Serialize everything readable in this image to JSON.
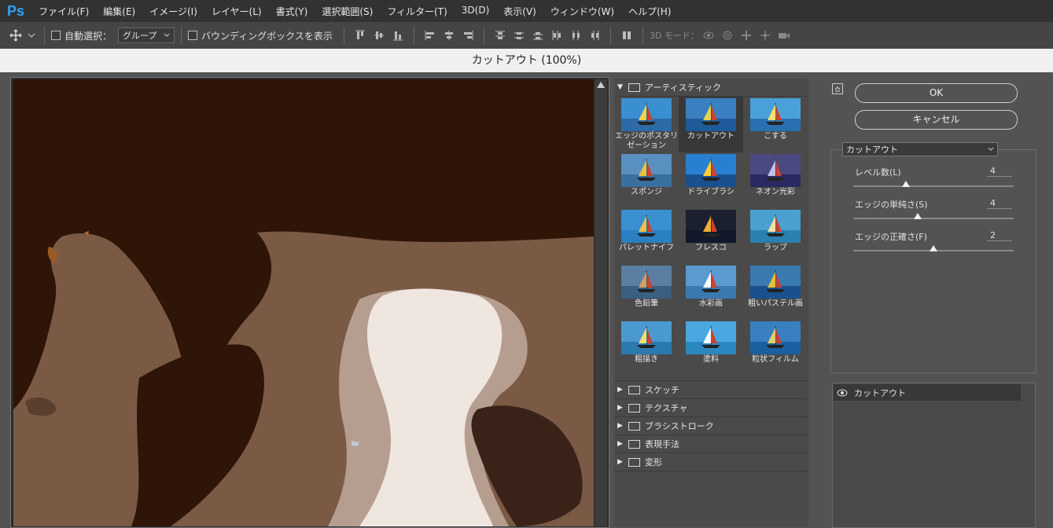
{
  "app": {
    "logo": "Ps"
  },
  "menu": [
    "ファイル(F)",
    "編集(E)",
    "イメージ(I)",
    "レイヤー(L)",
    "書式(Y)",
    "選択範囲(S)",
    "フィルター(T)",
    "3D(D)",
    "表示(V)",
    "ウィンドウ(W)",
    "ヘルプ(H)"
  ],
  "options": {
    "auto_select_label": "自動選択：",
    "auto_select_value": "グループ",
    "bbox_label": "バウンディングボックスを表示",
    "mode3d_label": "3D モード："
  },
  "dialog": {
    "title": "カットアウト (100%)"
  },
  "gallery": {
    "open_folder": "アーティスティック",
    "thumbnails": [
      {
        "label": "エッジのポスタリゼーション",
        "selected": false
      },
      {
        "label": "カットアウト",
        "selected": true
      },
      {
        "label": "こする",
        "selected": false
      },
      {
        "label": "スポンジ",
        "selected": false
      },
      {
        "label": "ドライブラシ",
        "selected": false
      },
      {
        "label": "ネオン光彩",
        "selected": false
      },
      {
        "label": "パレットナイフ",
        "selected": false
      },
      {
        "label": "フレスコ",
        "selected": false
      },
      {
        "label": "ラップ",
        "selected": false
      },
      {
        "label": "色鉛筆",
        "selected": false
      },
      {
        "label": "水彩画",
        "selected": false
      },
      {
        "label": "粗いパステル画",
        "selected": false
      },
      {
        "label": "粗描き",
        "selected": false
      },
      {
        "label": "塗料",
        "selected": false
      },
      {
        "label": "粒状フィルム",
        "selected": false
      }
    ],
    "folders": [
      "スケッチ",
      "テクスチャ",
      "ブラシストローク",
      "表現手法",
      "変形"
    ]
  },
  "buttons": {
    "ok": "OK",
    "cancel": "キャンセル"
  },
  "settings": {
    "filter": "カットアウト",
    "params": [
      {
        "label": "レベル数(L)",
        "value": "4",
        "level": 0.33
      },
      {
        "label": "エッジの単純さ(S)",
        "value": "4",
        "level": 0.4
      },
      {
        "label": "エッジの正確さ(F)",
        "value": "2",
        "level": 0.5
      }
    ]
  },
  "layers": {
    "row": "カットアウト"
  },
  "colors": {
    "accent": "#2fa3f5",
    "canvas_dark": "#2f1408",
    "canvas_mid": "#7a5a45",
    "canvas_light": "#f0e6e0"
  }
}
